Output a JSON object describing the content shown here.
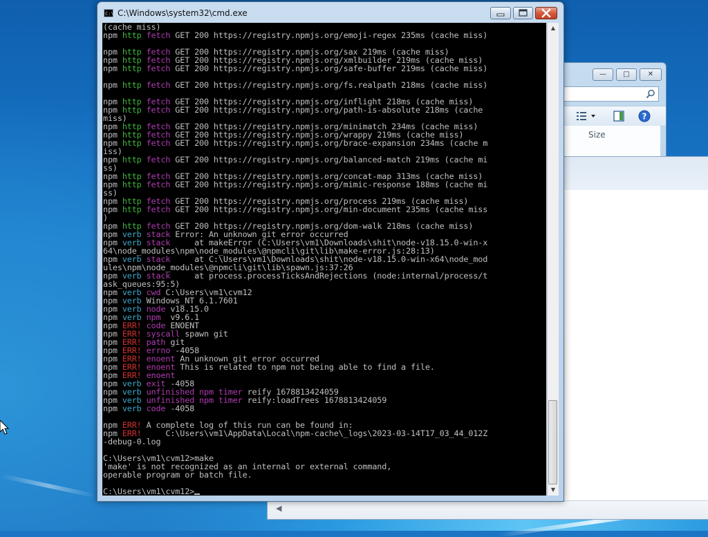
{
  "window": {
    "title": "C:\\Windows\\system32\\cmd.exe",
    "icon_label": "C:\\",
    "minimize": "—",
    "maximize": "□",
    "close": "✕"
  },
  "background_window": {
    "column_size": "Size"
  },
  "icons": {
    "minimize": "minimize-icon",
    "maximize": "maximize-icon",
    "close": "close-icon",
    "search": "search-icon",
    "view": "view-options-icon",
    "preview": "preview-pane-icon",
    "help": "help-icon",
    "scroll_up": "scroll-up-icon",
    "scroll_down": "scroll-down-icon"
  },
  "colors": {
    "console_bg": "#000000",
    "text_default": "#c0c0c0",
    "npm_http": "#3eb83e",
    "npm_fetch": "#b03cb0",
    "npm_verb": "#3aa8c8",
    "npm_err": "#d33030"
  },
  "console": {
    "lines": [
      [
        {
          "t": "(cache miss)",
          "c": "n"
        }
      ],
      [
        {
          "t": "npm ",
          "c": "n"
        },
        {
          "t": "http",
          "c": "g"
        },
        {
          "t": " ",
          "c": "n"
        },
        {
          "t": "fetch",
          "c": "m"
        },
        {
          "t": " GET 200 https://registry.npmjs.org/emoji-regex 235ms (cache miss)",
          "c": "n"
        }
      ],
      [],
      [
        {
          "t": "npm ",
          "c": "n"
        },
        {
          "t": "http",
          "c": "g"
        },
        {
          "t": " ",
          "c": "n"
        },
        {
          "t": "fetch",
          "c": "m"
        },
        {
          "t": " GET 200 https://registry.npmjs.org/sax 219ms (cache miss)",
          "c": "n"
        }
      ],
      [
        {
          "t": "npm ",
          "c": "n"
        },
        {
          "t": "http",
          "c": "g"
        },
        {
          "t": " ",
          "c": "n"
        },
        {
          "t": "fetch",
          "c": "m"
        },
        {
          "t": " GET 200 https://registry.npmjs.org/xmlbuilder 219ms (cache miss)",
          "c": "n"
        }
      ],
      [
        {
          "t": "npm ",
          "c": "n"
        },
        {
          "t": "http",
          "c": "g"
        },
        {
          "t": " ",
          "c": "n"
        },
        {
          "t": "fetch",
          "c": "m"
        },
        {
          "t": " GET 200 https://registry.npmjs.org/safe-buffer 219ms (cache miss)",
          "c": "n"
        }
      ],
      [],
      [
        {
          "t": "npm ",
          "c": "n"
        },
        {
          "t": "http",
          "c": "g"
        },
        {
          "t": " ",
          "c": "n"
        },
        {
          "t": "fetch",
          "c": "m"
        },
        {
          "t": " GET 200 https://registry.npmjs.org/fs.realpath 218ms (cache miss)",
          "c": "n"
        }
      ],
      [],
      [
        {
          "t": "npm ",
          "c": "n"
        },
        {
          "t": "http",
          "c": "g"
        },
        {
          "t": " ",
          "c": "n"
        },
        {
          "t": "fetch",
          "c": "m"
        },
        {
          "t": " GET 200 https://registry.npmjs.org/inflight 218ms (cache miss)",
          "c": "n"
        }
      ],
      [
        {
          "t": "npm ",
          "c": "n"
        },
        {
          "t": "http",
          "c": "g"
        },
        {
          "t": " ",
          "c": "n"
        },
        {
          "t": "fetch",
          "c": "m"
        },
        {
          "t": " GET 200 https://registry.npmjs.org/path-is-absolute 218ms (cache",
          "c": "n"
        }
      ],
      [
        {
          "t": "miss)",
          "c": "n"
        }
      ],
      [
        {
          "t": "npm ",
          "c": "n"
        },
        {
          "t": "http",
          "c": "g"
        },
        {
          "t": " ",
          "c": "n"
        },
        {
          "t": "fetch",
          "c": "m"
        },
        {
          "t": " GET 200 https://registry.npmjs.org/minimatch 234ms (cache miss)",
          "c": "n"
        }
      ],
      [
        {
          "t": "npm ",
          "c": "n"
        },
        {
          "t": "http",
          "c": "g"
        },
        {
          "t": " ",
          "c": "n"
        },
        {
          "t": "fetch",
          "c": "m"
        },
        {
          "t": " GET 200 https://registry.npmjs.org/wrappy 219ms (cache miss)",
          "c": "n"
        }
      ],
      [
        {
          "t": "npm ",
          "c": "n"
        },
        {
          "t": "http",
          "c": "g"
        },
        {
          "t": " ",
          "c": "n"
        },
        {
          "t": "fetch",
          "c": "m"
        },
        {
          "t": " GET 200 https://registry.npmjs.org/brace-expansion 234ms (cache m",
          "c": "n"
        }
      ],
      [
        {
          "t": "iss)",
          "c": "n"
        }
      ],
      [
        {
          "t": "npm ",
          "c": "n"
        },
        {
          "t": "http",
          "c": "g"
        },
        {
          "t": " ",
          "c": "n"
        },
        {
          "t": "fetch",
          "c": "m"
        },
        {
          "t": " GET 200 https://registry.npmjs.org/balanced-match 219ms (cache mi",
          "c": "n"
        }
      ],
      [
        {
          "t": "ss)",
          "c": "n"
        }
      ],
      [
        {
          "t": "npm ",
          "c": "n"
        },
        {
          "t": "http",
          "c": "g"
        },
        {
          "t": " ",
          "c": "n"
        },
        {
          "t": "fetch",
          "c": "m"
        },
        {
          "t": " GET 200 https://registry.npmjs.org/concat-map 313ms (cache miss)",
          "c": "n"
        }
      ],
      [
        {
          "t": "npm ",
          "c": "n"
        },
        {
          "t": "http",
          "c": "g"
        },
        {
          "t": " ",
          "c": "n"
        },
        {
          "t": "fetch",
          "c": "m"
        },
        {
          "t": " GET 200 https://registry.npmjs.org/mimic-response 188ms (cache mi",
          "c": "n"
        }
      ],
      [
        {
          "t": "ss)",
          "c": "n"
        }
      ],
      [
        {
          "t": "npm ",
          "c": "n"
        },
        {
          "t": "http",
          "c": "g"
        },
        {
          "t": " ",
          "c": "n"
        },
        {
          "t": "fetch",
          "c": "m"
        },
        {
          "t": " GET 200 https://registry.npmjs.org/process 219ms (cache miss)",
          "c": "n"
        }
      ],
      [
        {
          "t": "npm ",
          "c": "n"
        },
        {
          "t": "http",
          "c": "g"
        },
        {
          "t": " ",
          "c": "n"
        },
        {
          "t": "fetch",
          "c": "m"
        },
        {
          "t": " GET 200 https://registry.npmjs.org/min-document 235ms (cache miss",
          "c": "n"
        }
      ],
      [
        {
          "t": ")",
          "c": "n"
        }
      ],
      [
        {
          "t": "npm ",
          "c": "n"
        },
        {
          "t": "http",
          "c": "g"
        },
        {
          "t": " ",
          "c": "n"
        },
        {
          "t": "fetch",
          "c": "m"
        },
        {
          "t": " GET 200 https://registry.npmjs.org/dom-walk 218ms (cache miss)",
          "c": "n"
        }
      ],
      [
        {
          "t": "npm ",
          "c": "n"
        },
        {
          "t": "verb",
          "c": "c"
        },
        {
          "t": " ",
          "c": "n"
        },
        {
          "t": "stack",
          "c": "m"
        },
        {
          "t": " Error: An unknown git error occurred",
          "c": "n"
        }
      ],
      [
        {
          "t": "npm ",
          "c": "n"
        },
        {
          "t": "verb",
          "c": "c"
        },
        {
          "t": " ",
          "c": "n"
        },
        {
          "t": "stack",
          "c": "m"
        },
        {
          "t": "     at makeError (C:\\Users\\vm1\\Downloads\\shit\\node-v18.15.0-win-x",
          "c": "n"
        }
      ],
      [
        {
          "t": "64\\node_modules\\npm\\node_modules\\@npmcli\\git\\lib\\make-error.js:28:13)",
          "c": "n"
        }
      ],
      [
        {
          "t": "npm ",
          "c": "n"
        },
        {
          "t": "verb",
          "c": "c"
        },
        {
          "t": " ",
          "c": "n"
        },
        {
          "t": "stack",
          "c": "m"
        },
        {
          "t": "     at C:\\Users\\vm1\\Downloads\\shit\\node-v18.15.0-win-x64\\node_mod",
          "c": "n"
        }
      ],
      [
        {
          "t": "ules\\npm\\node_modules\\@npmcli\\git\\lib\\spawn.js:37:26",
          "c": "n"
        }
      ],
      [
        {
          "t": "npm ",
          "c": "n"
        },
        {
          "t": "verb",
          "c": "c"
        },
        {
          "t": " ",
          "c": "n"
        },
        {
          "t": "stack",
          "c": "m"
        },
        {
          "t": "     at process.processTicksAndRejections (node:internal/process/t",
          "c": "n"
        }
      ],
      [
        {
          "t": "ask_queues:95:5)",
          "c": "n"
        }
      ],
      [
        {
          "t": "npm ",
          "c": "n"
        },
        {
          "t": "verb",
          "c": "c"
        },
        {
          "t": " ",
          "c": "n"
        },
        {
          "t": "cwd",
          "c": "m"
        },
        {
          "t": " C:\\Users\\vm1\\cvm12",
          "c": "n"
        }
      ],
      [
        {
          "t": "npm ",
          "c": "n"
        },
        {
          "t": "verb",
          "c": "c"
        },
        {
          "t": " Windows_NT 6.1.7601",
          "c": "n"
        }
      ],
      [
        {
          "t": "npm ",
          "c": "n"
        },
        {
          "t": "verb",
          "c": "c"
        },
        {
          "t": " ",
          "c": "n"
        },
        {
          "t": "node",
          "c": "m"
        },
        {
          "t": " v18.15.0",
          "c": "n"
        }
      ],
      [
        {
          "t": "npm ",
          "c": "n"
        },
        {
          "t": "verb",
          "c": "c"
        },
        {
          "t": " ",
          "c": "n"
        },
        {
          "t": "npm",
          "c": "m"
        },
        {
          "t": "  v9.6.1",
          "c": "n"
        }
      ],
      [
        {
          "t": "npm ",
          "c": "n"
        },
        {
          "t": "ERR!",
          "c": "r"
        },
        {
          "t": " ",
          "c": "n"
        },
        {
          "t": "code",
          "c": "m"
        },
        {
          "t": " ENOENT",
          "c": "n"
        }
      ],
      [
        {
          "t": "npm ",
          "c": "n"
        },
        {
          "t": "ERR!",
          "c": "r"
        },
        {
          "t": " ",
          "c": "n"
        },
        {
          "t": "syscall",
          "c": "m"
        },
        {
          "t": " spawn git",
          "c": "n"
        }
      ],
      [
        {
          "t": "npm ",
          "c": "n"
        },
        {
          "t": "ERR!",
          "c": "r"
        },
        {
          "t": " ",
          "c": "n"
        },
        {
          "t": "path",
          "c": "m"
        },
        {
          "t": " git",
          "c": "n"
        }
      ],
      [
        {
          "t": "npm ",
          "c": "n"
        },
        {
          "t": "ERR!",
          "c": "r"
        },
        {
          "t": " ",
          "c": "n"
        },
        {
          "t": "errno",
          "c": "m"
        },
        {
          "t": " -4058",
          "c": "n"
        }
      ],
      [
        {
          "t": "npm ",
          "c": "n"
        },
        {
          "t": "ERR!",
          "c": "r"
        },
        {
          "t": " ",
          "c": "n"
        },
        {
          "t": "enoent",
          "c": "m"
        },
        {
          "t": " An unknown git error occurred",
          "c": "n"
        }
      ],
      [
        {
          "t": "npm ",
          "c": "n"
        },
        {
          "t": "ERR!",
          "c": "r"
        },
        {
          "t": " ",
          "c": "n"
        },
        {
          "t": "enoent",
          "c": "m"
        },
        {
          "t": " This is related to npm not being able to find a file.",
          "c": "n"
        }
      ],
      [
        {
          "t": "npm ",
          "c": "n"
        },
        {
          "t": "ERR!",
          "c": "r"
        },
        {
          "t": " ",
          "c": "n"
        },
        {
          "t": "enoent",
          "c": "m"
        }
      ],
      [
        {
          "t": "npm ",
          "c": "n"
        },
        {
          "t": "verb",
          "c": "c"
        },
        {
          "t": " ",
          "c": "n"
        },
        {
          "t": "exit",
          "c": "m"
        },
        {
          "t": " -4058",
          "c": "n"
        }
      ],
      [
        {
          "t": "npm ",
          "c": "n"
        },
        {
          "t": "verb",
          "c": "c"
        },
        {
          "t": " ",
          "c": "n"
        },
        {
          "t": "unfinished npm timer",
          "c": "m"
        },
        {
          "t": " reify 1678813424059",
          "c": "n"
        }
      ],
      [
        {
          "t": "npm ",
          "c": "n"
        },
        {
          "t": "verb",
          "c": "c"
        },
        {
          "t": " ",
          "c": "n"
        },
        {
          "t": "unfinished npm timer",
          "c": "m"
        },
        {
          "t": " reify:loadTrees 1678813424059",
          "c": "n"
        }
      ],
      [
        {
          "t": "npm ",
          "c": "n"
        },
        {
          "t": "verb",
          "c": "c"
        },
        {
          "t": " ",
          "c": "n"
        },
        {
          "t": "code",
          "c": "m"
        },
        {
          "t": " -4058",
          "c": "n"
        }
      ],
      [],
      [
        {
          "t": "npm ",
          "c": "n"
        },
        {
          "t": "ERR!",
          "c": "r"
        },
        {
          "t": " A complete log of this run can be found in:",
          "c": "n"
        }
      ],
      [
        {
          "t": "npm ",
          "c": "n"
        },
        {
          "t": "ERR!",
          "c": "r"
        },
        {
          "t": "     C:\\Users\\vm1\\AppData\\Local\\npm-cache\\_logs\\2023-03-14T17_03_44_012Z",
          "c": "n"
        }
      ],
      [
        {
          "t": "-debug-0.log",
          "c": "n"
        }
      ],
      [],
      [
        {
          "t": "C:\\Users\\vm1\\cvm12>make",
          "c": "n"
        }
      ],
      [
        {
          "t": "'make' is not recognized as an internal or external command,",
          "c": "n"
        }
      ],
      [
        {
          "t": "operable program or batch file.",
          "c": "n"
        }
      ],
      [],
      [
        {
          "t": "C:\\Users\\vm1\\cvm12>",
          "c": "n"
        }
      ]
    ]
  }
}
